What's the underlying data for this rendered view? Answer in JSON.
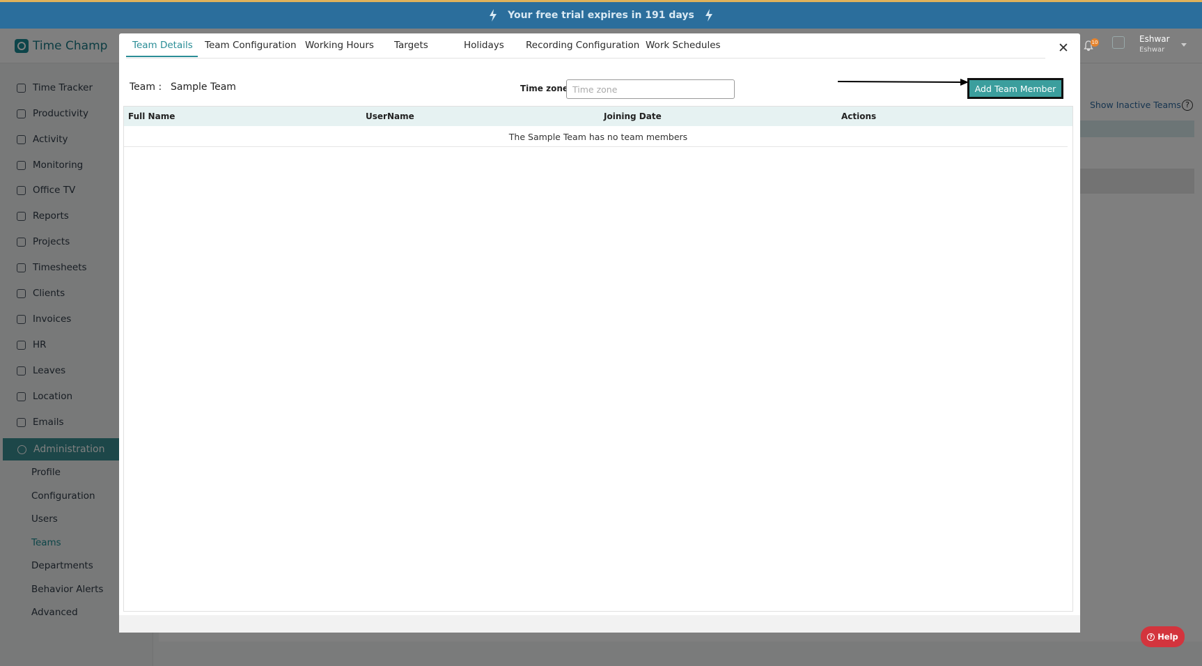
{
  "banner": {
    "text": "Your free trial expires in 191 days"
  },
  "app": {
    "name": "Time Champ"
  },
  "sidebar": {
    "items": [
      {
        "label": "Time Tracker",
        "icon": "clock-icon"
      },
      {
        "label": "Productivity",
        "icon": "chart-icon"
      },
      {
        "label": "Activity",
        "icon": "activity-icon"
      },
      {
        "label": "Monitoring",
        "icon": "monitor-icon"
      },
      {
        "label": "Office TV",
        "icon": "tv-icon"
      },
      {
        "label": "Reports",
        "icon": "pie-chart-icon"
      },
      {
        "label": "Projects",
        "icon": "briefcase-icon"
      },
      {
        "label": "Timesheets",
        "icon": "alarm-icon"
      },
      {
        "label": "Clients",
        "icon": "person-icon"
      },
      {
        "label": "Invoices",
        "icon": "invoice-icon"
      },
      {
        "label": "HR",
        "icon": "user-icon"
      },
      {
        "label": "Leaves",
        "icon": "calendar-icon"
      },
      {
        "label": "Location",
        "icon": "location-arrow-icon"
      },
      {
        "label": "Emails",
        "icon": "mail-icon"
      }
    ],
    "admin": {
      "label": "Administration",
      "icon": "gear-icon"
    },
    "sub_items": [
      {
        "label": "Profile"
      },
      {
        "label": "Configuration"
      },
      {
        "label": "Users"
      },
      {
        "label": "Teams",
        "active": true
      },
      {
        "label": "Departments"
      },
      {
        "label": "Behavior Alerts"
      },
      {
        "label": "Advanced"
      }
    ]
  },
  "header": {
    "notification_count": "10",
    "user_name": "Eshwar",
    "user_sub": "Eshwar"
  },
  "background": {
    "show_inactive_teams": "Show Inactive Teams",
    "help_glyph": "?"
  },
  "modal": {
    "tabs": [
      {
        "label": "Team Details",
        "active": true
      },
      {
        "label": "Team Configuration"
      },
      {
        "label": "Working Hours"
      },
      {
        "label": "Targets"
      },
      {
        "label": "Holidays"
      },
      {
        "label": "Recording Configuration"
      },
      {
        "label": "Work Schedules"
      }
    ],
    "close_glyph": "✕",
    "team_label": "Team :",
    "team_name": "Sample Team",
    "timezone_label": "Time zone :",
    "timezone_placeholder": "Time zone",
    "add_button": "Add Team Member",
    "table": {
      "columns": [
        "Full Name",
        "UserName",
        "Joining Date",
        "Actions"
      ],
      "empty_message": "The Sample Team has no team members"
    }
  },
  "help_button": {
    "label": "Help",
    "glyph": "?"
  },
  "colors": {
    "accent": "#3b9e9d",
    "banner": "#2b6e9c",
    "help": "#d3343d"
  }
}
